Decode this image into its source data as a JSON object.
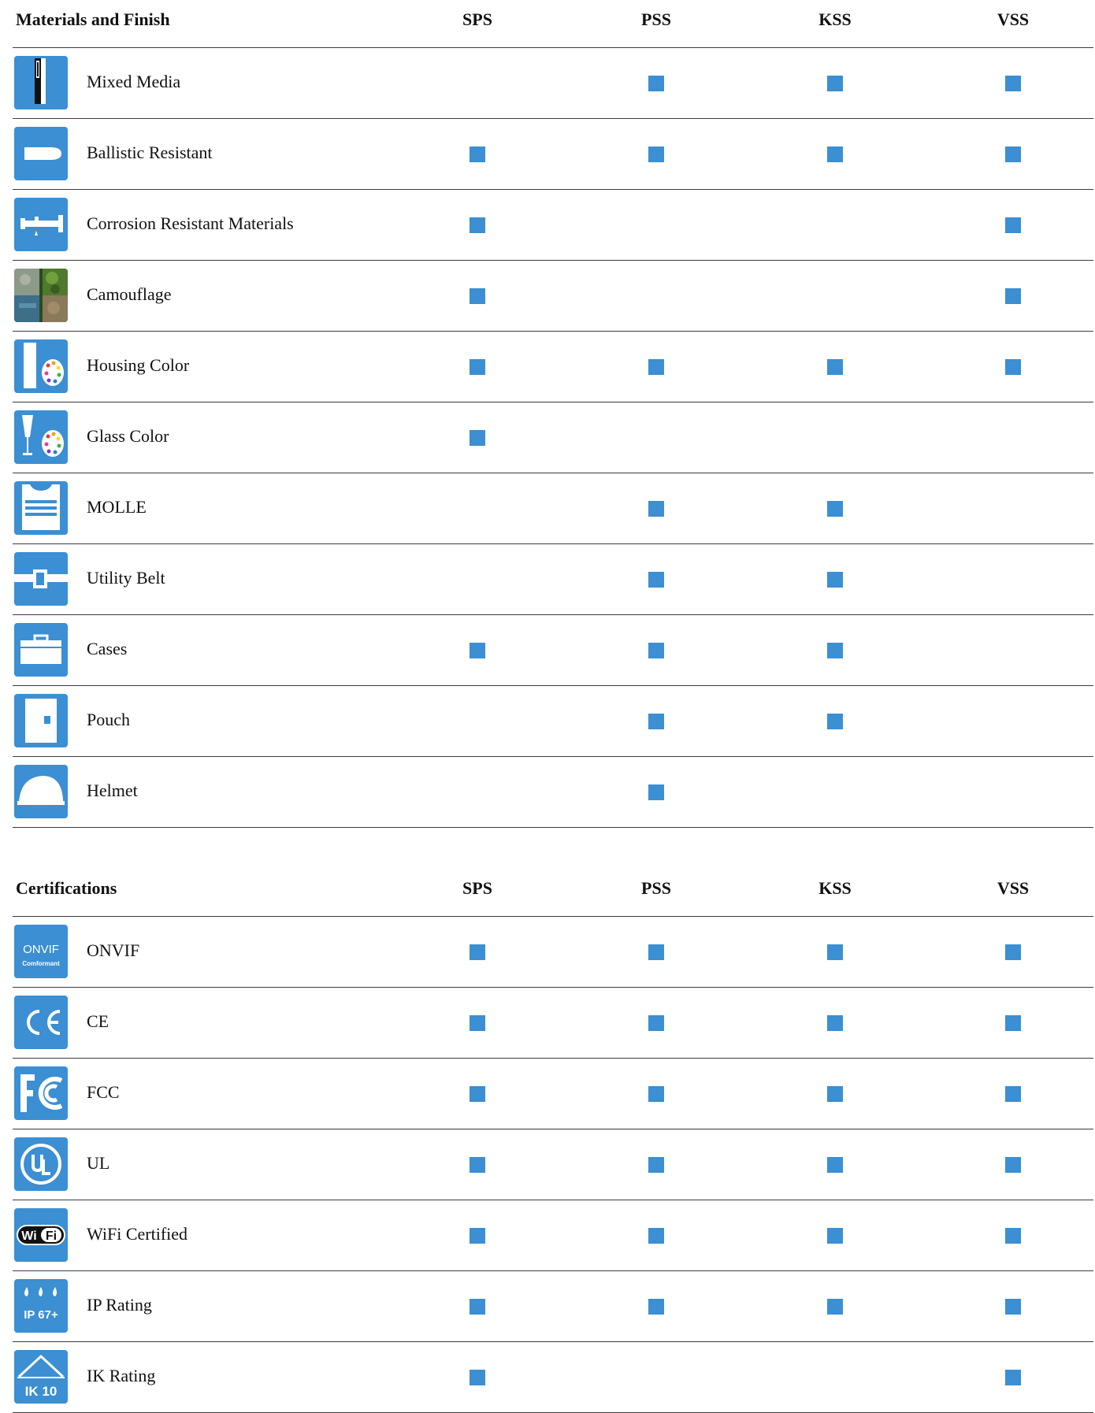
{
  "columns": [
    "SPS",
    "PSS",
    "KSS",
    "VSS"
  ],
  "materials": {
    "title": "Materials and Finish",
    "rows": [
      {
        "label": "Mixed Media",
        "icon": "mixed-media-icon",
        "checks": [
          false,
          true,
          true,
          true
        ]
      },
      {
        "label": "Ballistic Resistant",
        "icon": "bullet-icon",
        "checks": [
          true,
          true,
          true,
          true
        ]
      },
      {
        "label": "Corrosion Resistant Materials",
        "icon": "faucet-drip-icon",
        "checks": [
          true,
          false,
          false,
          true
        ]
      },
      {
        "label": "Camouflage",
        "icon": "camouflage-photo-icon",
        "checks": [
          true,
          false,
          false,
          true
        ]
      },
      {
        "label": "Housing Color",
        "icon": "housing-palette-icon",
        "checks": [
          true,
          true,
          true,
          true
        ]
      },
      {
        "label": "Glass Color",
        "icon": "glass-palette-icon",
        "checks": [
          true,
          false,
          false,
          false
        ]
      },
      {
        "label": "MOLLE",
        "icon": "molle-vest-icon",
        "checks": [
          false,
          true,
          true,
          false
        ]
      },
      {
        "label": "Utility Belt",
        "icon": "utility-belt-icon",
        "checks": [
          false,
          true,
          true,
          false
        ]
      },
      {
        "label": "Cases",
        "icon": "case-icon",
        "checks": [
          true,
          true,
          true,
          false
        ]
      },
      {
        "label": "Pouch",
        "icon": "pouch-icon",
        "checks": [
          false,
          true,
          true,
          false
        ]
      },
      {
        "label": "Helmet",
        "icon": "helmet-icon",
        "checks": [
          false,
          true,
          false,
          false
        ]
      }
    ]
  },
  "certifications": {
    "title": "Certifications",
    "rows": [
      {
        "label": "ONVIF",
        "icon": "onvif-logo-icon",
        "logo_text": "ONVIF Comformant",
        "checks": [
          true,
          true,
          true,
          true
        ]
      },
      {
        "label": "CE",
        "icon": "ce-mark-icon",
        "logo_text": "CE",
        "checks": [
          true,
          true,
          true,
          true
        ]
      },
      {
        "label": "FCC",
        "icon": "fcc-logo-icon",
        "logo_text": "FC",
        "checks": [
          true,
          true,
          true,
          true
        ]
      },
      {
        "label": "UL",
        "icon": "ul-logo-icon",
        "logo_text": "UL",
        "checks": [
          true,
          true,
          true,
          true
        ]
      },
      {
        "label": "WiFi Certified",
        "icon": "wifi-logo-icon",
        "logo_text": "WiFi",
        "checks": [
          true,
          true,
          true,
          true
        ]
      },
      {
        "label": "IP Rating",
        "icon": "ip-rating-icon",
        "logo_text": "IP 67+",
        "checks": [
          true,
          true,
          true,
          true
        ]
      },
      {
        "label": "IK Rating",
        "icon": "ik-rating-icon",
        "logo_text": "IK 10",
        "checks": [
          true,
          false,
          false,
          true
        ]
      }
    ]
  },
  "colors": {
    "accent": "#3b8fd2",
    "rule": "#3a3a3a",
    "text": "#111111"
  }
}
